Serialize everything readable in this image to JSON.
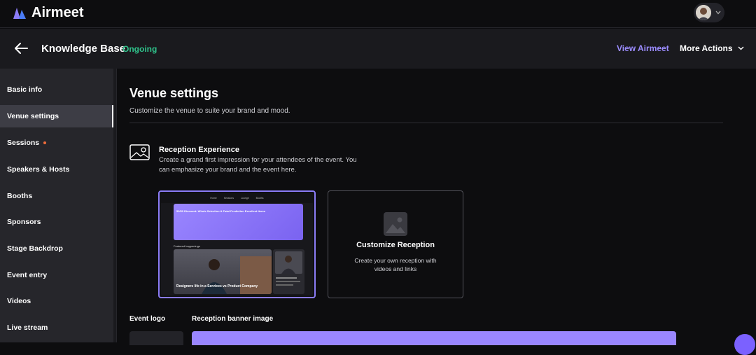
{
  "app": {
    "name": "Airmeet"
  },
  "header": {
    "event_title": "Knowledge Base",
    "status": "Ongoing",
    "view_link": "View Airmeet",
    "more_actions": "More Actions"
  },
  "sidebar": {
    "items": [
      {
        "label": "Basic info"
      },
      {
        "label": "Venue settings"
      },
      {
        "label": "Sessions"
      },
      {
        "label": "Speakers & Hosts"
      },
      {
        "label": "Booths"
      },
      {
        "label": "Sponsors"
      },
      {
        "label": "Stage Backdrop"
      },
      {
        "label": "Event entry"
      },
      {
        "label": "Videos"
      },
      {
        "label": "Live stream"
      }
    ]
  },
  "main": {
    "title": "Venue settings",
    "subtitle": "Customize the venue to suite your brand and mood.",
    "reception": {
      "title": "Reception Experience",
      "description": "Create a grand first impression for your attendees of the event. You can emphasize your brand and the event here."
    },
    "template_preview": {
      "nav": [
        "Home",
        "Sessions",
        "Lounge",
        "Booths"
      ],
      "banner_text": "50/50 Discount: Whole Selection & Fatal Prediction Excellent Items",
      "featured_label": "Featured happenings",
      "featured_title": "Designers life in a Services vs Product Company"
    },
    "customize_card": {
      "title": "Customize Reception",
      "description": "Create your own reception with videos and links"
    },
    "event_logo_label": "Event logo",
    "banner_label": "Reception banner image"
  },
  "colors": {
    "accent": "#8b7cf6",
    "status_green": "#2fc28b",
    "sidebar_bg": "#26262b",
    "banner": "#9a86ff"
  }
}
